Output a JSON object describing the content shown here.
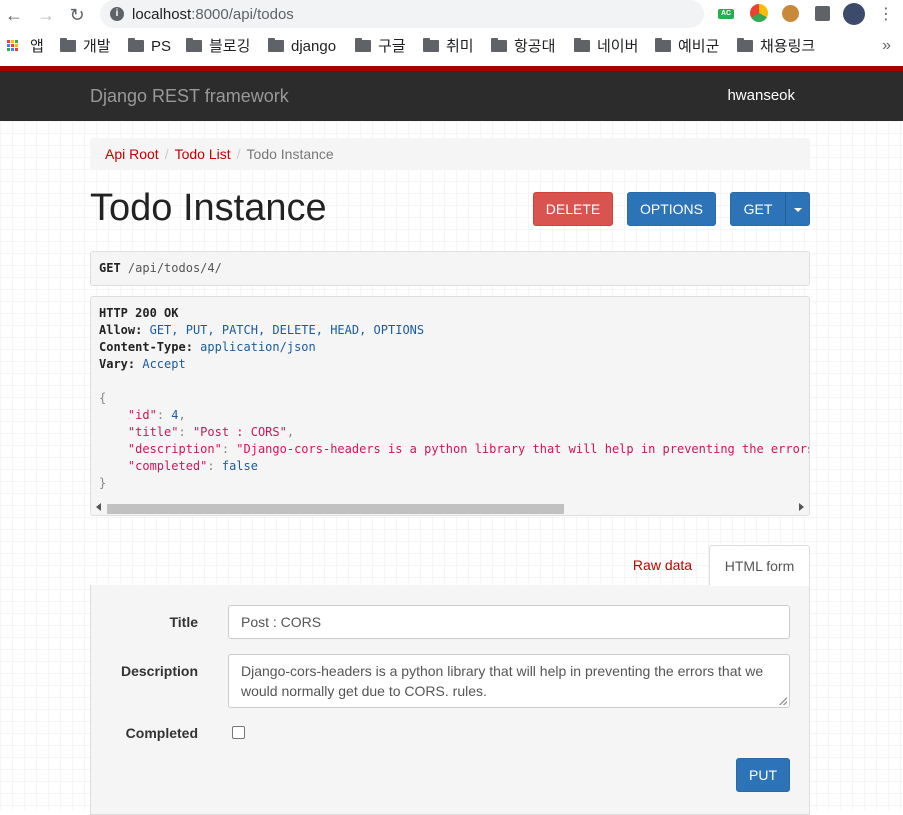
{
  "browser": {
    "url_host": "localhost",
    "url_path": ":8000/api/todos",
    "bookmarks": [
      {
        "label": "앱"
      },
      {
        "label": "개발"
      },
      {
        "label": "PS"
      },
      {
        "label": "블로깅"
      },
      {
        "label": "django"
      },
      {
        "label": "구글"
      },
      {
        "label": "취미"
      },
      {
        "label": "항공대"
      },
      {
        "label": "네이버"
      },
      {
        "label": "예비군"
      },
      {
        "label": "채용링크"
      }
    ],
    "more": "»",
    "ext_ac_label": "AC"
  },
  "navbar": {
    "brand": "Django REST framework",
    "user": "hwanseok"
  },
  "breadcrumb": {
    "items": [
      "Api Root",
      "Todo List",
      "Todo Instance"
    ],
    "separator": "/"
  },
  "page": {
    "title": "Todo Instance",
    "buttons": {
      "delete": "DELETE",
      "options": "OPTIONS",
      "get": "GET"
    }
  },
  "request": {
    "method": "GET",
    "path": "/api/todos/4/"
  },
  "response": {
    "status": "HTTP 200 OK",
    "headers": [
      {
        "key": "Allow:",
        "value": "GET, PUT, PATCH, DELETE, HEAD, OPTIONS"
      },
      {
        "key": "Content-Type:",
        "value": "application/json"
      },
      {
        "key": "Vary:",
        "value": "Accept"
      }
    ],
    "body": {
      "id": "4",
      "title": "\"Post : CORS\"",
      "description": "\"Django-cors-headers is a python library that will help in preventing the errors",
      "completed": "false"
    },
    "keys": {
      "id": "\"id\"",
      "title": "\"title\"",
      "description": "\"description\"",
      "completed": "\"completed\""
    }
  },
  "tabs": {
    "raw": "Raw data",
    "html": "HTML form"
  },
  "form": {
    "title_label": "Title",
    "title_value": "Post : CORS",
    "description_label": "Description",
    "description_value": "Django-cors-headers is a python library that will help in preventing the errors that we would normally get due to CORS. rules.",
    "completed_label": "Completed",
    "completed_value": false,
    "submit": "PUT"
  },
  "colors": {
    "navbar": "#2c2c2c",
    "accent_red": "#c20000",
    "primary": "#2c73b8",
    "danger": "#d9534f"
  }
}
